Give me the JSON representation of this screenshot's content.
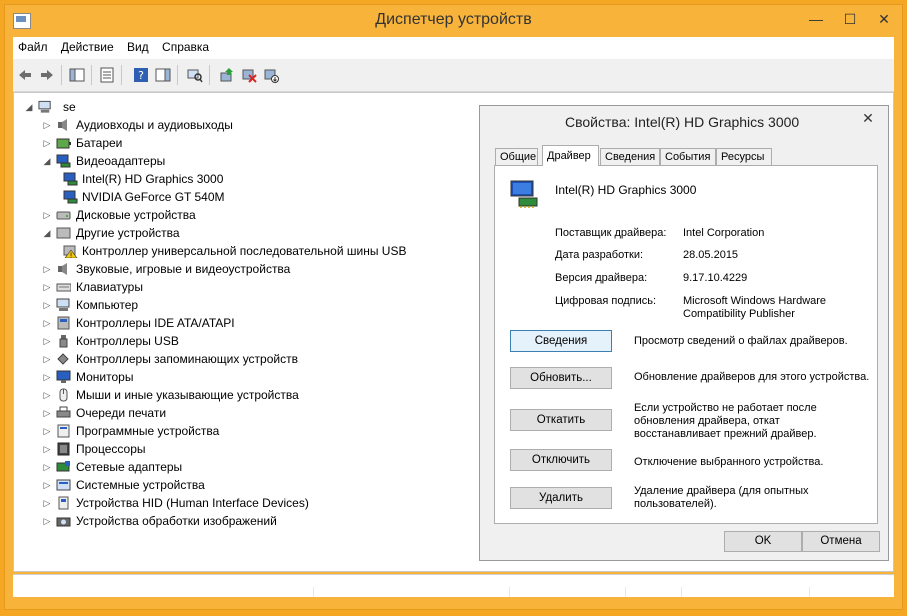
{
  "window": {
    "title": "Диспетчер устройств"
  },
  "menu": [
    "Файл",
    "Действие",
    "Вид",
    "Справка"
  ],
  "tree": {
    "root": "se",
    "items": [
      {
        "label": "Аудиовходы и аудиовыходы",
        "icon": "speaker-icon",
        "expanded": false,
        "level": 1
      },
      {
        "label": "Батареи",
        "icon": "battery-icon",
        "expanded": false,
        "level": 1
      },
      {
        "label": "Видеоадаптеры",
        "icon": "display-adapter-icon",
        "expanded": true,
        "level": 1
      },
      {
        "label": "Intel(R) HD Graphics 3000",
        "icon": "display-adapter-icon",
        "level": 2
      },
      {
        "label": "NVIDIA GeForce GT 540M",
        "icon": "display-adapter-icon",
        "level": 2
      },
      {
        "label": "Дисковые устройства",
        "icon": "disk-icon",
        "expanded": false,
        "level": 1
      },
      {
        "label": "Другие устройства",
        "icon": "unknown-device-icon",
        "expanded": true,
        "level": 1
      },
      {
        "label": "Контроллер универсальной последовательной шины USB",
        "icon": "warning-device-icon",
        "level": 2
      },
      {
        "label": "Звуковые, игровые и видеоустройства",
        "icon": "speaker-icon",
        "expanded": false,
        "level": 1
      },
      {
        "label": "Клавиатуры",
        "icon": "keyboard-icon",
        "expanded": false,
        "level": 1
      },
      {
        "label": "Компьютер",
        "icon": "computer-icon",
        "expanded": false,
        "level": 1
      },
      {
        "label": "Контроллеры IDE ATA/ATAPI",
        "icon": "ide-controller-icon",
        "expanded": false,
        "level": 1
      },
      {
        "label": "Контроллеры USB",
        "icon": "usb-icon",
        "expanded": false,
        "level": 1
      },
      {
        "label": "Контроллеры запоминающих устройств",
        "icon": "storage-controller-icon",
        "expanded": false,
        "level": 1
      },
      {
        "label": "Мониторы",
        "icon": "monitor-icon",
        "expanded": false,
        "level": 1
      },
      {
        "label": "Мыши и иные указывающие устройства",
        "icon": "mouse-icon",
        "expanded": false,
        "level": 1
      },
      {
        "label": "Очереди печати",
        "icon": "printer-icon",
        "expanded": false,
        "level": 1
      },
      {
        "label": "Программные устройства",
        "icon": "software-device-icon",
        "expanded": false,
        "level": 1
      },
      {
        "label": "Процессоры",
        "icon": "processor-icon",
        "expanded": false,
        "level": 1
      },
      {
        "label": "Сетевые адаптеры",
        "icon": "network-adapter-icon",
        "expanded": false,
        "level": 1
      },
      {
        "label": "Системные устройства",
        "icon": "system-device-icon",
        "expanded": false,
        "level": 1
      },
      {
        "label": "Устройства HID (Human Interface Devices)",
        "icon": "hid-icon",
        "expanded": false,
        "level": 1
      },
      {
        "label": "Устройства обработки изображений",
        "icon": "camera-icon",
        "expanded": false,
        "level": 1
      }
    ]
  },
  "dialog": {
    "title": "Свойства: Intel(R) HD Graphics 3000",
    "tabs": [
      "Общие",
      "Драйвер",
      "Сведения",
      "События",
      "Ресурсы"
    ],
    "active_tab": "Драйвер",
    "device_name": "Intel(R) HD Graphics 3000",
    "provider_label": "Поставщик драйвера:",
    "provider_value": "Intel Corporation",
    "date_label": "Дата разработки:",
    "date_value": "28.05.2015",
    "version_label": "Версия драйвера:",
    "version_value": "9.17.10.4229",
    "signature_label": "Цифровая подпись:",
    "signature_value_1": "Microsoft Windows Hardware",
    "signature_value_2": "Compatibility Publisher",
    "details_button": "Сведения",
    "details_desc": "Просмотр сведений о файлах драйверов.",
    "update_button": "Обновить...",
    "update_desc": "Обновление драйверов для этого устройства.",
    "rollback_button": "Откатить",
    "rollback_desc_1": "Если устройство не работает после",
    "rollback_desc_2": "обновления драйвера, откат",
    "rollback_desc_3": "восстанавливает прежний драйвер.",
    "disable_button": "Отключить",
    "disable_desc": "Отключение выбранного устройства.",
    "uninstall_button": "Удалить",
    "uninstall_desc_1": "Удаление драйвера (для опытных",
    "uninstall_desc_2": "пользователей).",
    "ok_button": "OK",
    "cancel_button": "Отмена"
  }
}
